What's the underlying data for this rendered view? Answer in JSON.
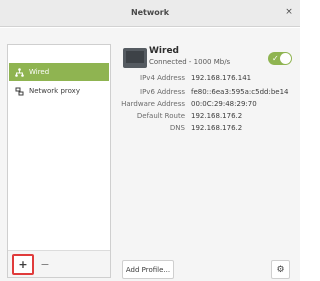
{
  "window": {
    "title": "Network",
    "close_icon": "×"
  },
  "sidebar": {
    "items": [
      {
        "label": "Wired",
        "icon": "network-wired-icon",
        "active": true
      },
      {
        "label": "Network proxy",
        "icon": "network-proxy-icon",
        "active": false
      }
    ],
    "add_label": "+",
    "remove_label": "−"
  },
  "device": {
    "name": "Wired",
    "status": "Connected - 1000 Mb/s",
    "enabled": true,
    "toggle_check": "✓"
  },
  "details": [
    {
      "label": "IPv4 Address",
      "value": "192.168.176.141"
    },
    {
      "label": "IPv6 Address",
      "value": "fe80::6ea3:595a:c5dd:be14"
    },
    {
      "label": "Hardware Address",
      "value": "00:0C:29:48:29:70"
    },
    {
      "label": "Default Route",
      "value": "192.168.176.2"
    },
    {
      "label": "DNS",
      "value": "192.168.176.2"
    }
  ],
  "footer": {
    "add_profile_label": "Add Profile...",
    "settings_icon": "⚙"
  },
  "colors": {
    "accent": "#8fb451",
    "highlight_border": "#e03b3b"
  }
}
